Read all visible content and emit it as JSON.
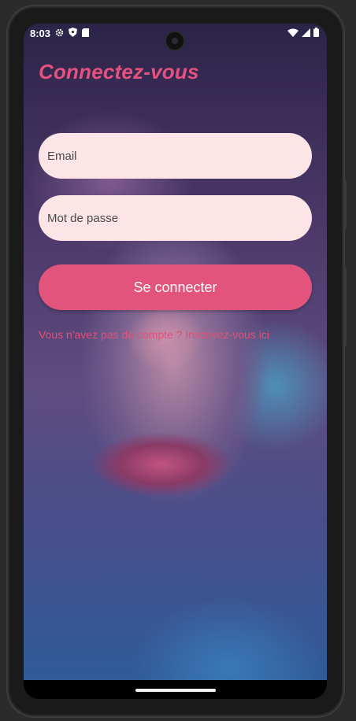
{
  "status_bar": {
    "time": "8:03",
    "left_icons": [
      "gear-icon",
      "shield-icon",
      "sd-card-icon"
    ],
    "right_icons": [
      "wifi-icon",
      "signal-icon",
      "battery-icon"
    ]
  },
  "login": {
    "title": "Connectez-vous",
    "email_placeholder": "Email",
    "password_placeholder": "Mot de passe",
    "submit_label": "Se connecter",
    "signup_link": "Vous n'avez pas de compte ? Inscrivez-vous ici"
  },
  "colors": {
    "accent": "#e6517f",
    "button": "#e2547c",
    "field_background": "#fde4e6"
  }
}
